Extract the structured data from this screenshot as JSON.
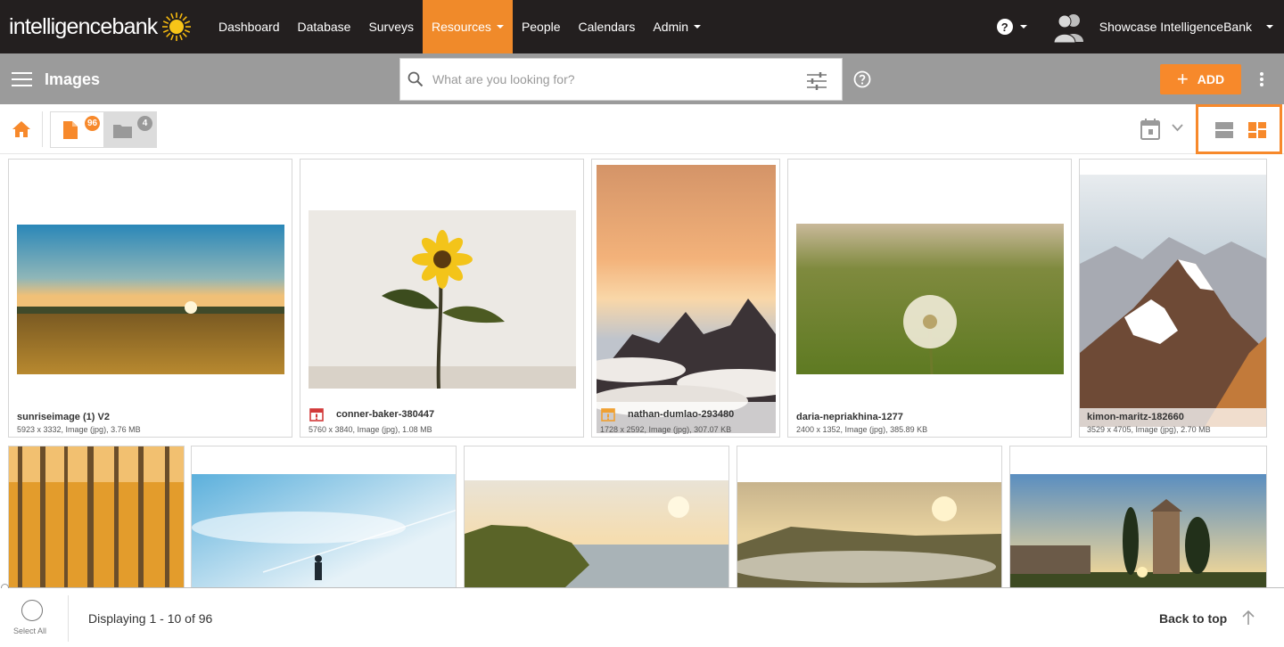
{
  "brand": {
    "logo_text": "intelligencebank",
    "accent": "#f7892b",
    "topbar_bg": "#231f1f",
    "subheader_bg": "#9b9b9b"
  },
  "nav": {
    "items": [
      {
        "label": "Dashboard",
        "active": false,
        "dropdown": false
      },
      {
        "label": "Database",
        "active": false,
        "dropdown": false
      },
      {
        "label": "Surveys",
        "active": false,
        "dropdown": false
      },
      {
        "label": "Resources",
        "active": true,
        "dropdown": true
      },
      {
        "label": "People",
        "active": false,
        "dropdown": false
      },
      {
        "label": "Calendars",
        "active": false,
        "dropdown": false
      },
      {
        "label": "Admin",
        "active": false,
        "dropdown": true
      }
    ],
    "help_icon": "question-circle-icon",
    "user_name": "Showcase IntelligenceBank"
  },
  "subheader": {
    "title": "Images",
    "search_placeholder": "What are you looking for?",
    "add_label": "ADD"
  },
  "toolbar": {
    "files_count": "96",
    "folders_count": "4"
  },
  "cards": [
    {
      "name": "sunriseimage (1) V2",
      "meta": "5923 x 3332, Image (jpg), 3.76 MB",
      "status": "none"
    },
    {
      "name": "conner-baker-380447",
      "meta": "5760 x 3840, Image (jpg), 1.08 MB",
      "status": "expired"
    },
    {
      "name": "nathan-dumlao-293480",
      "meta": "1728 x 2592, Image (jpg), 307.07 KB",
      "status": "warning"
    },
    {
      "name": "daria-nepriakhina-1277",
      "meta": "2400 x 1352, Image (jpg), 385.89 KB",
      "status": "none"
    },
    {
      "name": "kimon-maritz-182660",
      "meta": "3529 x 4705, Image (jpg), 2.70 MB",
      "status": "none"
    },
    {
      "name": "",
      "meta": "",
      "status": "none"
    },
    {
      "name": "",
      "meta": "",
      "status": "none"
    },
    {
      "name": "",
      "meta": "",
      "status": "none"
    },
    {
      "name": "",
      "meta": "",
      "status": "none"
    },
    {
      "name": "",
      "meta": "",
      "status": "none"
    }
  ],
  "footer": {
    "select_all_label": "Select All",
    "displaying_text": "Displaying 1 - 10 of 96",
    "back_to_top_label": "Back to top"
  }
}
